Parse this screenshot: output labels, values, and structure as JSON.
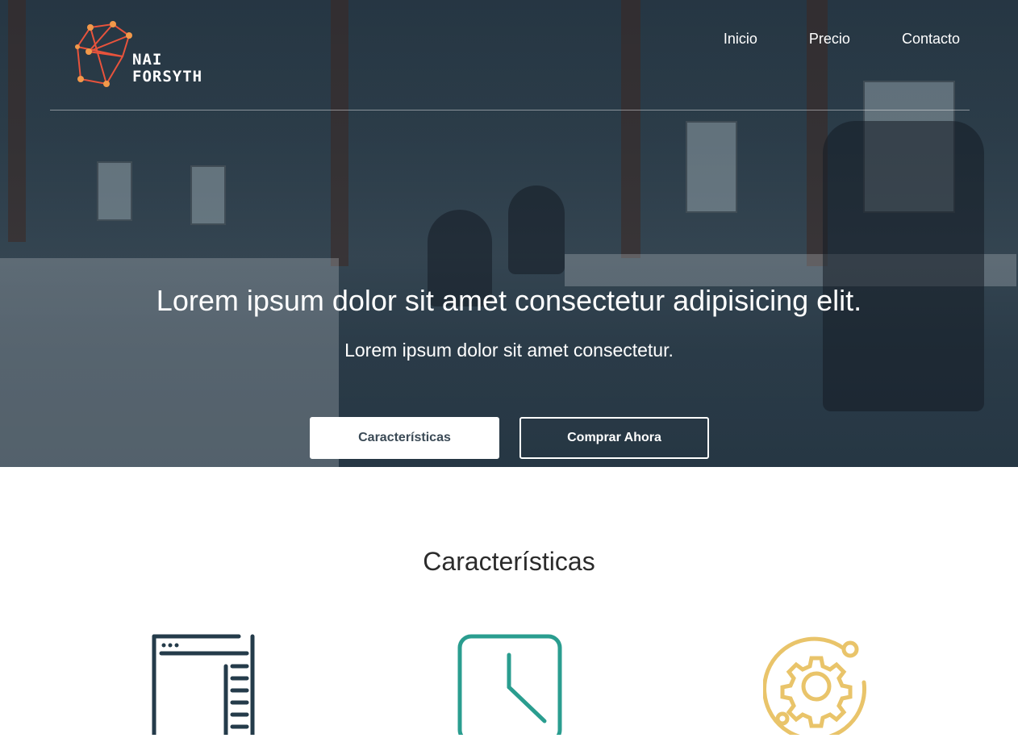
{
  "brand": {
    "line1": "NAI",
    "line2": "FORSYTH",
    "icon": "network-logo-icon",
    "colors": {
      "logo_orange": "#f2994a",
      "logo_red": "#e8533c"
    }
  },
  "nav": {
    "items": [
      {
        "label": "Inicio"
      },
      {
        "label": "Precio"
      },
      {
        "label": "Contacto"
      }
    ]
  },
  "hero": {
    "title": "Lorem ipsum dolor sit amet consectetur adipisicing elit.",
    "subtitle": "Lorem ipsum dolor sit amet consectetur.",
    "buttons": {
      "features": "Características",
      "buy": "Comprar Ahora"
    },
    "overlay_color": "#1e303e"
  },
  "features": {
    "title": "Características",
    "icons": [
      {
        "name": "browser-layout-icon",
        "color": "#243b4a"
      },
      {
        "name": "clock-icon",
        "color": "#2a9d8f"
      },
      {
        "name": "gear-orbit-icon",
        "color": "#e9c46a"
      }
    ]
  }
}
